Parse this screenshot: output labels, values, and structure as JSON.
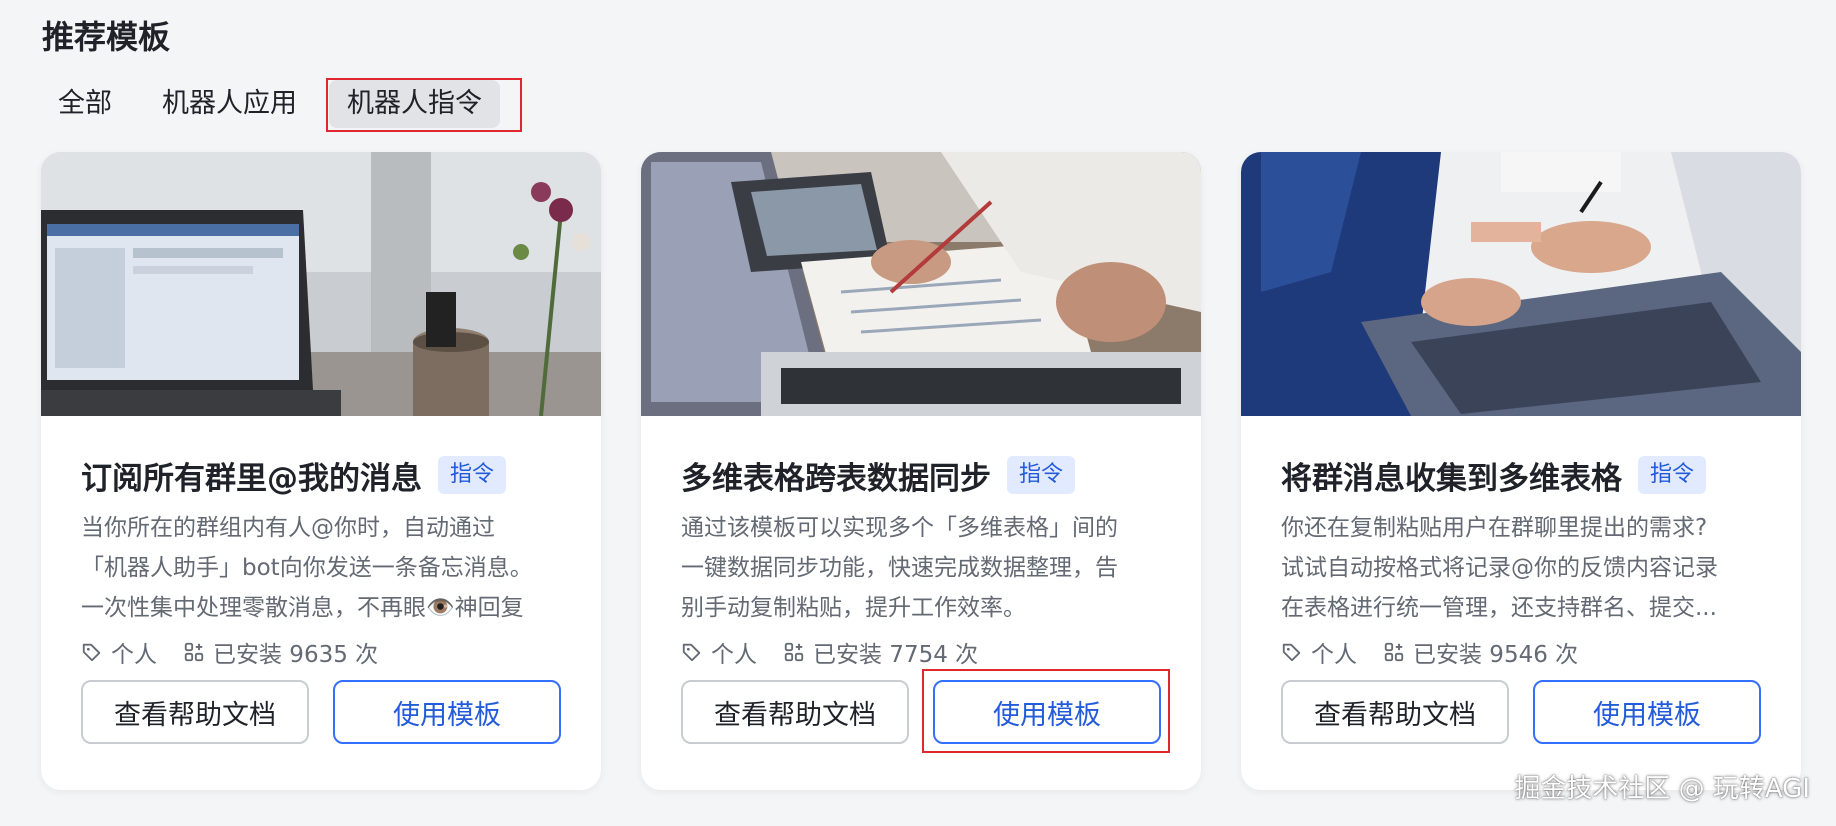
{
  "section": {
    "title": "推荐模板"
  },
  "tabs": [
    {
      "label": "全部",
      "active": false
    },
    {
      "label": "机器人应用",
      "active": false
    },
    {
      "label": "机器人指令",
      "active": true
    }
  ],
  "cards": [
    {
      "title": "订阅所有群里@我的消息",
      "tag": "指令",
      "desc": [
        "当你所在的群组内有人@你时，自动通过",
        "「机器人助手」bot向你发送一条备忘消息。",
        "一次性集中处理零散消息，不再眼👁️神回复"
      ],
      "scope": "个人",
      "installs": "已安装 9635 次",
      "help_label": "查看帮助文档",
      "use_label": "使用模板",
      "image": "laptop-on-desk-with-flowers-photo"
    },
    {
      "title": "多维表格跨表数据同步",
      "tag": "指令",
      "desc": [
        "通过该模板可以实现多个「多维表格」间的",
        "一键数据同步功能，快速完成数据整理，告",
        "别手动复制粘贴，提升工作效率。"
      ],
      "scope": "个人",
      "installs": "已安装 7754 次",
      "help_label": "查看帮助文档",
      "use_label": "使用模板",
      "image": "team-reviewing-documents-photo"
    },
    {
      "title": "将群消息收集到多维表格",
      "tag": "指令",
      "desc": [
        "你还在复制粘贴用户在群聊里提出的需求?",
        "试试自动按格式将记录@你的反馈内容记录",
        "在表格进行统一管理，还支持群名、提交..."
      ],
      "scope": "个人",
      "installs": "已安装 9546 次",
      "help_label": "查看帮助文档",
      "use_label": "使用模板",
      "image": "hands-typing-on-laptop-photo"
    }
  ],
  "watermark": "掘金技术社区 @ 玩转AGI",
  "colors": {
    "accent": "#3370ff",
    "tag_bg": "#e1eaff",
    "highlight": "#e0262f"
  }
}
